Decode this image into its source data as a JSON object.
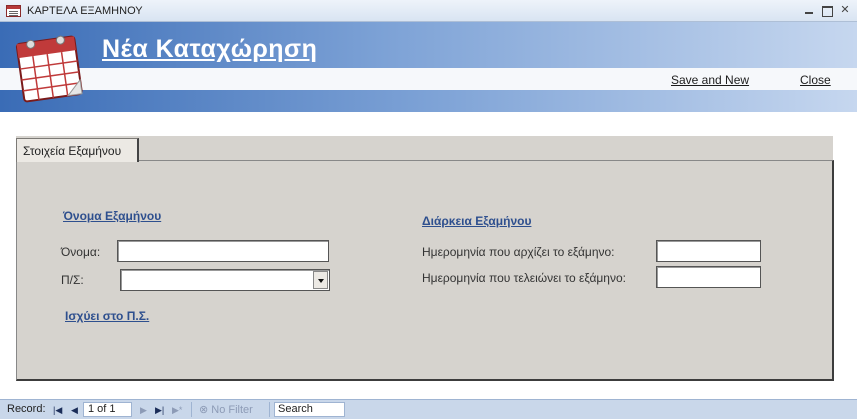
{
  "window": {
    "title": "ΚΑΡΤΕΛΑ ΕΞΑΜΗΝΟΥ"
  },
  "header": {
    "form_title": "Νέα Καταχώρηση",
    "save_and_new": "Save and New",
    "close": "Close",
    "icon": "calendar-icon"
  },
  "tabs": [
    {
      "label": "Στοιχεία Εξαμήνου",
      "active": true
    }
  ],
  "semester_name_section": {
    "heading": "Όνομα Εξαμήνου",
    "name_label": "Όνομα:",
    "name_value": "",
    "program_label": "Π/Σ:",
    "program_value": "",
    "applies_link": "Ισχύει στο Π.Σ."
  },
  "duration_section": {
    "heading": "Διάρκεια Εξαμήνου",
    "start_label": "Ημερομηνία που αρχίζει το εξάμηνο:",
    "start_value": "",
    "end_label": "Ημερομηνία που τελειώνει το εξάμηνο:",
    "end_value": ""
  },
  "record_nav": {
    "record_label": "Record:",
    "position": "1 of 1",
    "filter_label": "No Filter",
    "search_label": "Search"
  },
  "colors": {
    "header_blue": "#3a6cb6",
    "section_heading": "#2e4f8e",
    "panel": "#d6d3ce"
  }
}
